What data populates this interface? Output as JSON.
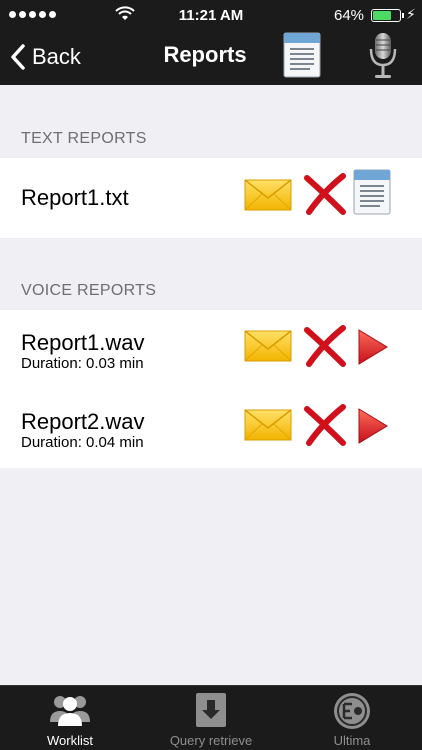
{
  "status_bar": {
    "time": "11:21 AM",
    "battery_percent": "64%",
    "battery_level": 0.64,
    "signal_dots": 5
  },
  "nav": {
    "back_label": "Back",
    "title": "Reports"
  },
  "text_reports": {
    "header": "TEXT REPORTS",
    "items": [
      {
        "name": "Report1.txt"
      }
    ]
  },
  "voice_reports": {
    "header": "VOICE REPORTS",
    "items": [
      {
        "name": "Report1.wav",
        "duration": "Duration: 0.03 min"
      },
      {
        "name": "Report2.wav",
        "duration": "Duration: 0.04 min"
      }
    ]
  },
  "tabs": [
    {
      "label": "Worklist",
      "icon": "users-icon",
      "active": true
    },
    {
      "label": "Query retrieve",
      "icon": "download-icon",
      "active": false
    },
    {
      "label": "Ultima",
      "icon": "ultima-logo-icon",
      "active": false
    }
  ],
  "colors": {
    "bar_bg": "#1b1b1b",
    "page_bg": "#efeff4",
    "battery_green": "#4cd964",
    "tab_inactive": "#8e8e8e"
  }
}
